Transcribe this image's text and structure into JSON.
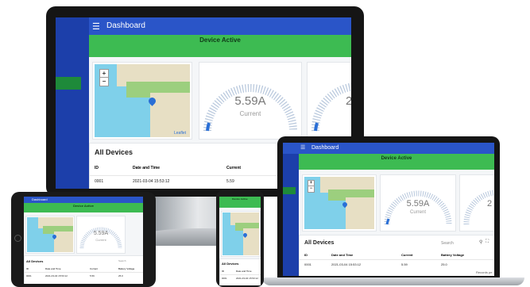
{
  "app": {
    "title": "Dashboard",
    "menu_icon": "hamburger-menu-icon",
    "banner": "Device Active",
    "map_zoom_in": "+",
    "map_zoom_out": "−",
    "map_attribution": "Leaflet",
    "gauge": {
      "value_text": "5.59A",
      "label": "Current",
      "value": 5.59,
      "second_value_partial": "2"
    },
    "devices": {
      "title": "All Devices",
      "search_placeholder": "Search",
      "columns": [
        "ID",
        "Date and Time",
        "Current",
        "Battery Voltage"
      ],
      "rows": [
        {
          "id": "0001",
          "datetime": "2021-03-04 15:53:12",
          "current": "5.59",
          "battery": "25.0"
        }
      ],
      "footer_partial": "Records pe"
    }
  },
  "colors": {
    "sidebar": "#1c3faa",
    "topbar": "#2a55c8",
    "banner": "#3dbb52",
    "active_nav": "#1e8a3a",
    "gauge_arc": "#b7c7dc",
    "gauge_fill": "#2a6fd6"
  },
  "icons": [
    "hamburger-menu-icon",
    "map-pin-icon",
    "search-icon",
    "fullscreen-icon"
  ]
}
